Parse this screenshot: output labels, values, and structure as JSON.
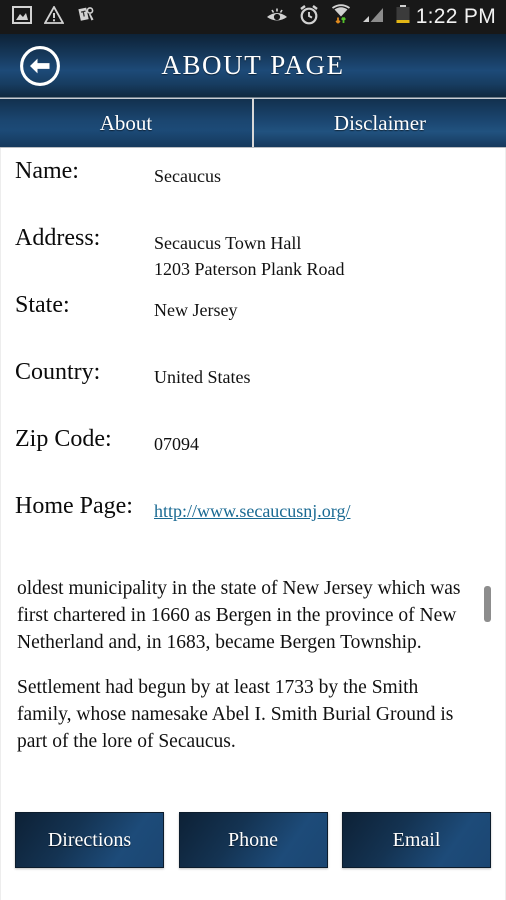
{
  "statusbar": {
    "time": "1:22 PM",
    "left_icons": [
      "image-icon",
      "warning-triangle-icon",
      "carrier-key-tag-icon"
    ],
    "right_icons": [
      "smart-stay-eye-icon",
      "alarm-clock-icon",
      "wifi-data-transfer-icon",
      "cell-signal-icon",
      "battery-low-icon"
    ],
    "colors": {
      "background": "#181818",
      "icon": "#d2d2d2",
      "battery_accent": "#e3b616",
      "text": "#f2f2f2"
    }
  },
  "header": {
    "title": "ABOUT PAGE",
    "back_icon": "back-arrow-circle-icon",
    "colors": {
      "gradient_top": "#0d2237",
      "gradient_mid": "#1d4a78",
      "gradient_bottom": "#10293f",
      "title": "#ffffff"
    }
  },
  "tabs": [
    {
      "label": "About",
      "selected": true
    },
    {
      "label": "Disclaimer",
      "selected": false
    }
  ],
  "fields": [
    {
      "label": "Name:",
      "lines": [
        "Secaucus"
      ],
      "type": "text"
    },
    {
      "label": "Address:",
      "lines": [
        "Secaucus Town Hall",
        "1203 Paterson Plank Road"
      ],
      "type": "text"
    },
    {
      "label": "State:",
      "lines": [
        "New Jersey"
      ],
      "type": "text"
    },
    {
      "label": "Country:",
      "lines": [
        "United States"
      ],
      "type": "text"
    },
    {
      "label": "Zip Code:",
      "lines": [
        "07094"
      ],
      "type": "text"
    },
    {
      "label": "Home Page:",
      "lines": [
        "http://www.secaucusnj.org/"
      ],
      "type": "link"
    }
  ],
  "description": {
    "paragraph1": "oldest municipality in the state of New Jersey which was first chartered in 1660 as Bergen in the province of New Netherland and, in 1683, became Bergen Township.",
    "paragraph2": "Settlement had begun by at least 1733 by the Smith family, whose namesake Abel I. Smith Burial Ground is part of the lore of Secaucus."
  },
  "actions": [
    {
      "label": "Directions"
    },
    {
      "label": "Phone"
    },
    {
      "label": "Email"
    }
  ],
  "link_color": "#1a6a93"
}
